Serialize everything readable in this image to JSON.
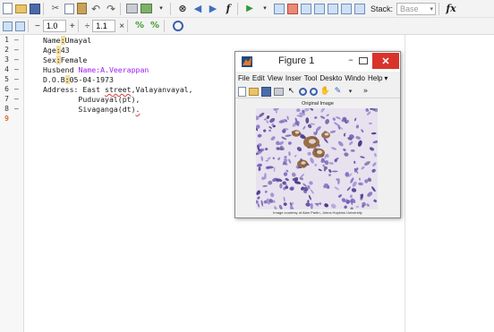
{
  "toolbar": {
    "row1_icons": [
      "new-icon",
      "open-icon",
      "save-icon",
      "cut-icon",
      "copy-icon",
      "paste-icon",
      "undo-icon",
      "redo-icon",
      "print-icon",
      "go-to-icon",
      "binoculars-icon",
      "back-arrow-icon",
      "forward-arrow-icon",
      "fx-function-icon",
      "run-icon",
      "breakpoint-set-icon",
      "breakpoint-clear-icon",
      "step-icon",
      "step-in-icon",
      "step-out-icon",
      "continue-icon"
    ],
    "stack_label": "Stack:",
    "stack_value": "Base",
    "fx_label": "fx"
  },
  "cell_toolbar": {
    "minus": "−",
    "value1": "1.0",
    "plus": "+",
    "divide": "÷",
    "value2": "1.1",
    "times": "×"
  },
  "editor": {
    "lines": [
      {
        "num": "1",
        "text_before": "Name",
        "hl": ":",
        "text_after": "Umayal"
      },
      {
        "num": "2",
        "text_before": "Age",
        "hl": ":",
        "text_after": "43"
      },
      {
        "num": "3",
        "text_before": "Sex",
        "hl": ":",
        "text_after": "Female"
      },
      {
        "num": "4",
        "text_before": "Husbend ",
        "purple": "Name:A.Veerappan"
      },
      {
        "num": "5",
        "text_before": "D.O.B",
        "hl": ":",
        "text_after": "05-04-1973"
      },
      {
        "num": "6",
        "text_before": "Address: East ",
        "squiggle": "street",
        "text_after": ",Valayanvayal,"
      },
      {
        "num": "7",
        "text_before": "        Puduvayal(pt),"
      },
      {
        "num": "8",
        "text_before": "        Sivaganga(dt)",
        "squiggle": "."
      },
      {
        "num": "9"
      }
    ]
  },
  "figure": {
    "title": "Figure 1",
    "minimize": "–",
    "close": "✕",
    "menu": [
      "File",
      "Edit",
      "View",
      "Inser",
      "Tool",
      "Deskto",
      "Windo",
      "Help"
    ],
    "menu_more": "▾",
    "tools_more": "»",
    "image_title": "Original Image",
    "caption": "Image courtesy of Alan Partin, Johns Hopkins University"
  },
  "colors": {
    "highlight": "#f3dc9d",
    "string_purple": "#a020f0",
    "close_red": "#d9342b",
    "stain_purple": "#5a4aa6",
    "stain_brown": "#8a5a2c"
  }
}
